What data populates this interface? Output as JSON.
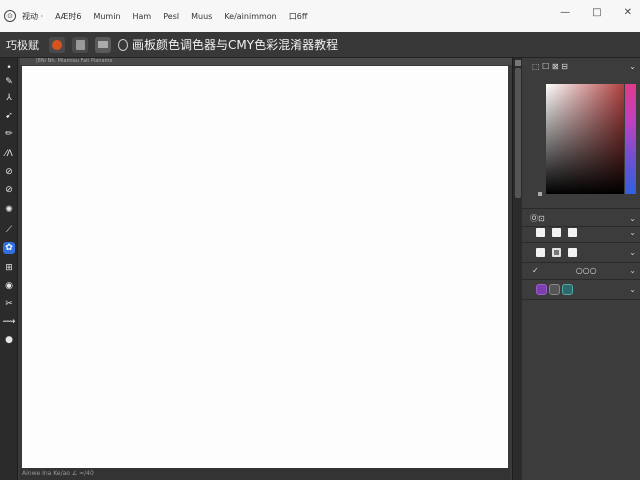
{
  "menubar": {
    "items": [
      "视动 ·",
      "AÆ时6",
      "Mumin",
      "Ham",
      "Pesl",
      "Muus",
      "Ke/ainimmon",
      "口6ff"
    ],
    "controls": [
      "—",
      "□",
      "✕"
    ]
  },
  "docbar": {
    "app_name": "巧极赋",
    "document_title": "画板颜色调色器与CMY色彩混淆器教程"
  },
  "canvas": {
    "header_text": "|8Ni Nh.   Miamiau Fait   Pianame",
    "status_text": "Ainwe    Ina Ke/ao  ∠  ≈/40"
  },
  "toolbar": {
    "tools": [
      "•",
      "✎",
      "⅄",
      "➹",
      "✏",
      "⁄ᐱ",
      "⊘",
      "⊘",
      "✺",
      "⟋",
      "✿",
      "⊞",
      "◉",
      "✂",
      "⟿",
      "●"
    ],
    "active_index": 10
  },
  "panel": {
    "header_label": "⬚ ☐ ⊠ ⊟",
    "section_title": "Ⓞ⊡",
    "layers_label": "○○○",
    "check_glyph": "✓",
    "chevron": "⌄"
  },
  "colors": {
    "accent": "#2f6fe0",
    "brush_purple": "#7b3fb0",
    "orange_button": "#d9531e"
  }
}
